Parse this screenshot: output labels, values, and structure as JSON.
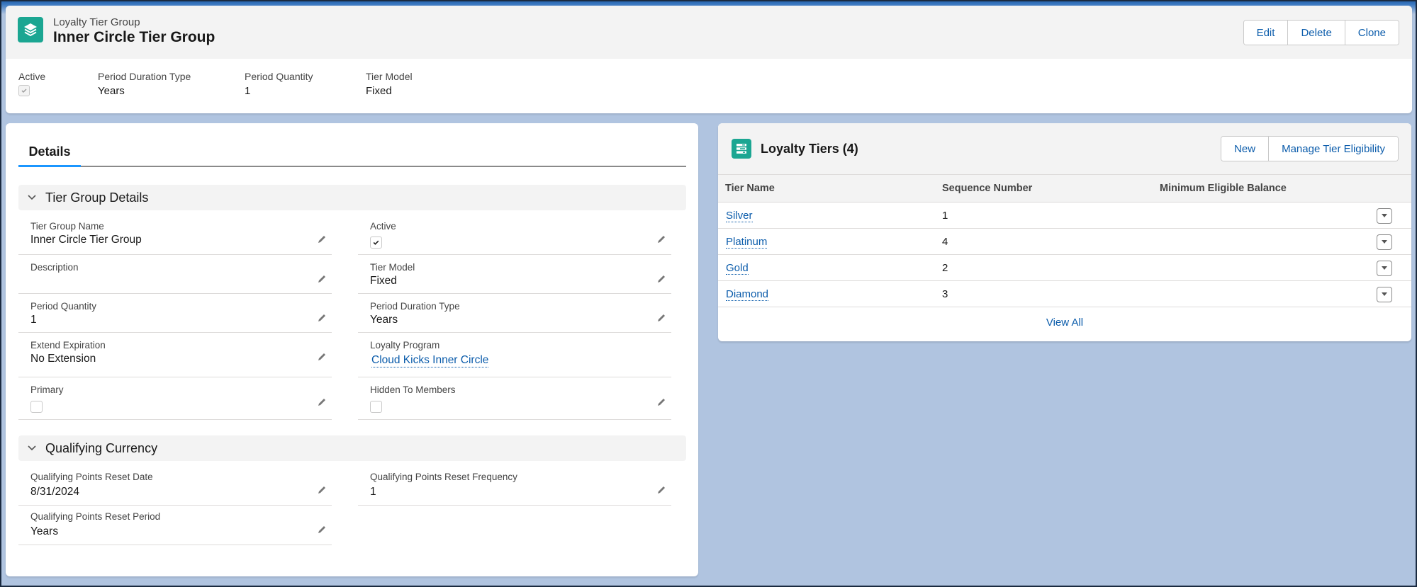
{
  "header": {
    "object_type": "Loyalty Tier Group",
    "title": "Inner Circle Tier Group",
    "icon": "layers-icon",
    "actions": [
      "Edit",
      "Delete",
      "Clone"
    ],
    "highlights": [
      {
        "label": "Active",
        "value": "",
        "type": "checkbox",
        "checked": true
      },
      {
        "label": "Period Duration Type",
        "value": "Years"
      },
      {
        "label": "Period Quantity",
        "value": "1"
      },
      {
        "label": "Tier Model",
        "value": "Fixed"
      }
    ]
  },
  "details": {
    "tab_label": "Details",
    "sections": [
      {
        "title": "Tier Group Details",
        "fields": [
          {
            "label": "Tier Group Name",
            "value": "Inner Circle Tier Group"
          },
          {
            "label": "Active",
            "type": "checkbox",
            "checked": true
          },
          {
            "label": "Description",
            "value": ""
          },
          {
            "label": "Tier Model",
            "value": "Fixed"
          },
          {
            "label": "Period Quantity",
            "value": "1"
          },
          {
            "label": "Period Duration Type",
            "value": "Years"
          },
          {
            "label": "Extend Expiration",
            "value": "No Extension"
          },
          {
            "label": "Loyalty Program",
            "value": "Cloud Kicks Inner Circle",
            "type": "link"
          },
          {
            "label": "Primary",
            "type": "checkbox",
            "checked": false
          },
          {
            "label": "Hidden To Members",
            "type": "checkbox",
            "checked": false
          }
        ]
      },
      {
        "title": "Qualifying Currency",
        "fields": [
          {
            "label": "Qualifying Points Reset Date",
            "value": "8/31/2024"
          },
          {
            "label": "Qualifying Points Reset Frequency",
            "value": "1"
          },
          {
            "label": "Qualifying Points Reset Period",
            "value": "Years"
          }
        ]
      }
    ]
  },
  "related_list": {
    "title": "Loyalty Tiers (4)",
    "icon": "list-icon",
    "actions": [
      "New",
      "Manage Tier Eligibility"
    ],
    "columns": [
      "Tier Name",
      "Sequence Number",
      "Minimum Eligible Balance"
    ],
    "rows": [
      {
        "name": "Silver",
        "sequence": "1",
        "min_balance": ""
      },
      {
        "name": "Platinum",
        "sequence": "4",
        "min_balance": ""
      },
      {
        "name": "Gold",
        "sequence": "2",
        "min_balance": ""
      },
      {
        "name": "Diamond",
        "sequence": "3",
        "min_balance": ""
      }
    ],
    "view_all": "View All"
  },
  "colors": {
    "brand_icon": "#1ba692",
    "link": "#0b5cab",
    "tab_active": "#1b96ff",
    "background": "#b0c4e0"
  }
}
